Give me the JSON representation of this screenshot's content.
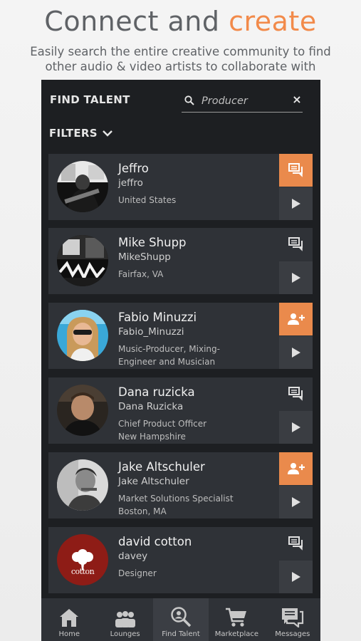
{
  "promo": {
    "headline_part1": "Connect and ",
    "headline_part2": "create",
    "subline_1": "Easily search the entire creative community to find",
    "subline_2": "other audio & video artists to collaborate with"
  },
  "header": {
    "title": "FIND TALENT",
    "search_value": "",
    "search_placeholder": "Producer",
    "filters_label": "FILTERS"
  },
  "colors": {
    "accent": "#ea8a4c",
    "panel": "#2f3237",
    "background": "#1d1f22"
  },
  "results": [
    {
      "name": "Jeffro",
      "username": "jeffro",
      "details": [
        "United States"
      ],
      "action": "message",
      "action_highlight": true
    },
    {
      "name": "Mike Shupp",
      "username": "MikeShupp",
      "details": [
        "Fairfax, VA"
      ],
      "action": "message",
      "action_highlight": false
    },
    {
      "name": "Fabio Minuzzi",
      "username": "Fabio_Minuzzi",
      "details": [
        "Music-Producer, Mixing-",
        "Engineer and Musician"
      ],
      "action": "add-user",
      "action_highlight": true
    },
    {
      "name": "Dana ruzicka",
      "username": "Dana Ruzicka",
      "details": [
        "Chief Product Officer",
        "New Hampshire"
      ],
      "action": "message",
      "action_highlight": false
    },
    {
      "name": "Jake Altschuler",
      "username": "Jake Altschuler",
      "details": [
        "Market Solutions Specialist",
        "Boston, MA"
      ],
      "action": "add-user",
      "action_highlight": true
    },
    {
      "name": "david cotton",
      "username": "davey",
      "details": [
        "Designer"
      ],
      "action": "message",
      "action_highlight": false
    }
  ],
  "nav": {
    "home": "Home",
    "lounges": "Lounges",
    "find_talent": "Find Talent",
    "marketplace": "Marketplace",
    "messages": "Messages",
    "active": "find_talent"
  }
}
